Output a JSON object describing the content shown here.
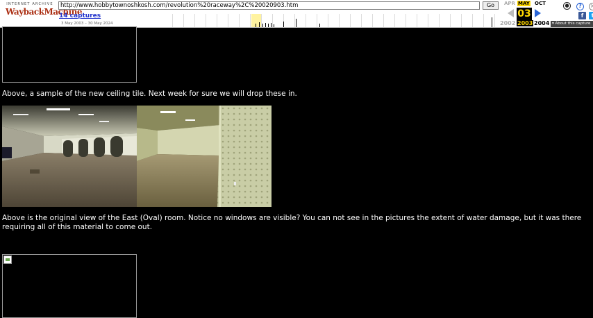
{
  "toolbar": {
    "logo_top": "INTERNET ARCHIVE",
    "logo_main": "WaybackMachine",
    "url": "http://www.hobbytownoshkosh.com/revolution%20raceway%2C%20020903.htm",
    "go_label": "Go",
    "captures_label": "14 captures",
    "date_range": "3 May 2003 – 30 May 2024",
    "about_label": "About this capture"
  },
  "calendar": {
    "prev_month": "APR",
    "current_month": "MAY",
    "next_month": "OCT",
    "day": "03",
    "prev_year": "2002",
    "current_year": "2003",
    "next_year": "2004"
  },
  "content": {
    "caption_ceiling": "Above, a sample of the new ceiling tile.  Next week for sure we will drop these in.",
    "caption_east_room": "Above is the original view of the East (Oval) room.  Notice no windows are visible?  You can not see in the pictures the extent of water damage, but it was there requiring all of this material to come out."
  },
  "icons": [
    "user-icon",
    "help-icon",
    "share-icon",
    "facebook-icon",
    "twitter-icon"
  ],
  "colors": {
    "page_bg": "#000000",
    "text": "#ffffff",
    "link": "#2233cc",
    "wayback_red": "#ab2e12",
    "calendar_highlight": "#ffd700"
  }
}
